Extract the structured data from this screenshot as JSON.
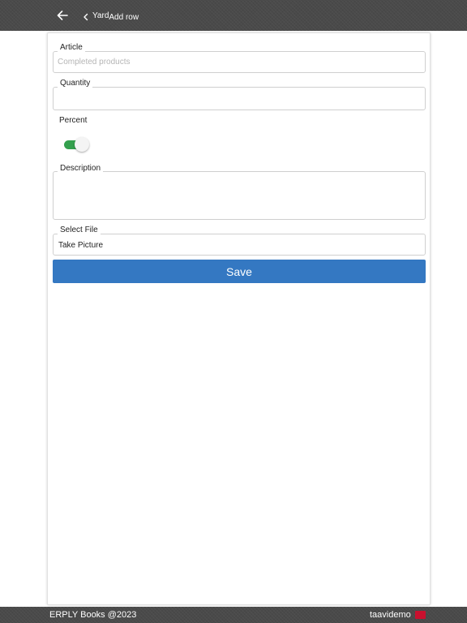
{
  "header": {
    "back_icon": "arrow-left-icon",
    "breadcrumb_parent": "Yard",
    "breadcrumb_current": "Add row"
  },
  "form": {
    "article": {
      "label": "Article",
      "placeholder": "Completed products",
      "value": ""
    },
    "quantity": {
      "label": "Quantity",
      "value": ""
    },
    "percent": {
      "label": "Percent",
      "enabled": true
    },
    "description": {
      "label": "Description",
      "value": ""
    },
    "file": {
      "label": "Select File",
      "value": "Take Picture"
    },
    "save_label": "Save"
  },
  "footer": {
    "copyright": "ERPLY Books @2023",
    "username": "taavidemo",
    "flag_icon": "flag-icon"
  },
  "colors": {
    "header_bg": "#4a4a4a",
    "primary_button": "#3478c2",
    "toggle_on": "#34a04e"
  }
}
